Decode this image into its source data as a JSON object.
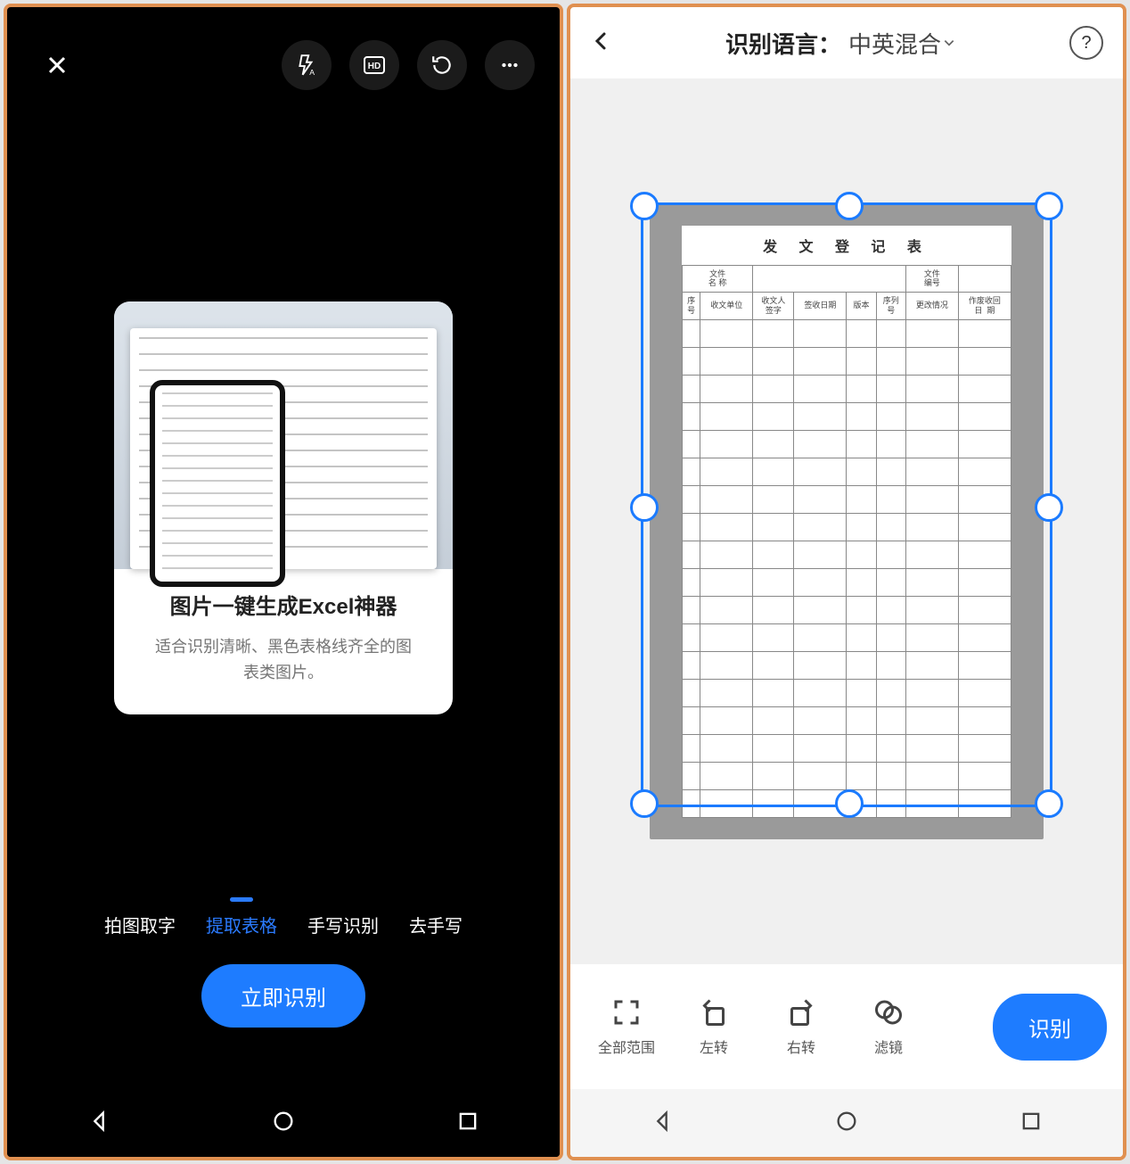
{
  "left": {
    "card": {
      "title": "图片一键生成Excel神器",
      "desc": "适合识别清晰、黑色表格线齐全的图表类图片。"
    },
    "modes": [
      {
        "label": "拍图取字",
        "active": false
      },
      {
        "label": "提取表格",
        "active": true
      },
      {
        "label": "手写识别",
        "active": false
      },
      {
        "label": "去手写",
        "active": false
      }
    ],
    "action_button": "立即识别"
  },
  "right": {
    "header": {
      "title_label": "识别语言：",
      "title_value": "中英混合"
    },
    "document": {
      "title": "发 文 登 记 表",
      "row1": {
        "c1": "文件\n名 称",
        "c2": "文件\n编号"
      },
      "columns": [
        "序\n号",
        "收文单位",
        "收文人\n签字",
        "签收日期",
        "版本",
        "序列\n号",
        "更改情况",
        "作废收回\n日  期"
      ]
    },
    "tools": [
      {
        "id": "full-range",
        "label": "全部范围"
      },
      {
        "id": "rotate-left",
        "label": "左转"
      },
      {
        "id": "rotate-right",
        "label": "右转"
      },
      {
        "id": "filter",
        "label": "滤镜"
      }
    ],
    "recognize_button": "识别"
  }
}
